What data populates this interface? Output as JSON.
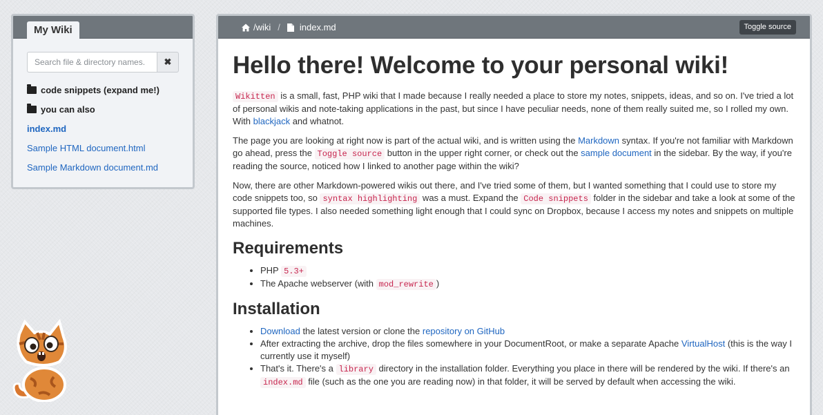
{
  "sidebar": {
    "title": "My Wiki",
    "search_placeholder": "Search file & directory names.",
    "clear_icon": "close-icon",
    "items": [
      {
        "type": "folder",
        "label": "code snippets (expand me!)"
      },
      {
        "type": "folder",
        "label": "you can also"
      },
      {
        "type": "file",
        "label": "index.md",
        "active": true
      },
      {
        "type": "file",
        "label": "Sample HTML document.html"
      },
      {
        "type": "file",
        "label": "Sample Markdown document.md"
      }
    ]
  },
  "header": {
    "crumb_wiki": "/wiki",
    "separator": "/",
    "crumb_file": "index.md",
    "toggle_source": "Toggle source"
  },
  "content": {
    "h1": "Hello there! Welcome to your personal wiki!",
    "p1": {
      "code": "Wikitten",
      "text1": " is a small, fast, PHP wiki that I made because I really needed a place to store my notes, snippets, ideas, and so on. I've tried a lot of personal wikis and note-taking applications in the past, but since I have peculiar needs, none of them really suited me, so I rolled my own. With ",
      "link": "blackjack",
      "text2": " and whatnot."
    },
    "p2": {
      "text1": "The page you are looking at right now is part of the actual wiki, and is written using the ",
      "link1": "Markdown",
      "text2": " syntax. If you're not familiar with Markdown go ahead, press the ",
      "code": "Toggle source",
      "text3": " button in the upper right corner, or check out the ",
      "link2": "sample document",
      "text4": " in the sidebar. By the way, if you're reading the source, noticed how I linked to another page within the wiki?"
    },
    "p3": {
      "text1": "Now, there are other Markdown-powered wikis out there, and I've tried some of them, but I wanted something that I could use to store my code snippets too, so ",
      "code1": "syntax highlighting",
      "text2": " was a must. Expand the ",
      "code2": "Code snippets",
      "text3": " folder in the sidebar and take a look at some of the supported file types. I also needed something light enough that I could sync on Dropbox, because I access my notes and snippets on multiple machines."
    },
    "h2_requirements": "Requirements",
    "req1": {
      "text": "PHP ",
      "code": "5.3+"
    },
    "req2": {
      "text1": "The Apache webserver (with ",
      "code": "mod_rewrite",
      "text2": ")"
    },
    "h2_installation": "Installation",
    "inst1": {
      "link1": "Download",
      "text1": " the latest version or clone the ",
      "link2": "repository on GitHub"
    },
    "inst2": {
      "text1": "After extracting the archive, drop the files somewhere in your DocumentRoot, or make a separate Apache ",
      "link": "VirtualHost",
      "text2": " (this is the way I currently use it myself)"
    },
    "inst3": {
      "text1": "That's it. There's a ",
      "code1": "library",
      "text2": " directory in the installation folder. Everything you place in there will be rendered by the wiki. If there's an ",
      "code2": "index.md",
      "text3": " file (such as the one you are reading now) in that folder, it will be served by default when accessing the wiki."
    }
  },
  "colors": {
    "header_bg": "#6f767c",
    "link": "#1f66c0",
    "code": "#c7254e",
    "code_bg": "#f9f2f4"
  }
}
